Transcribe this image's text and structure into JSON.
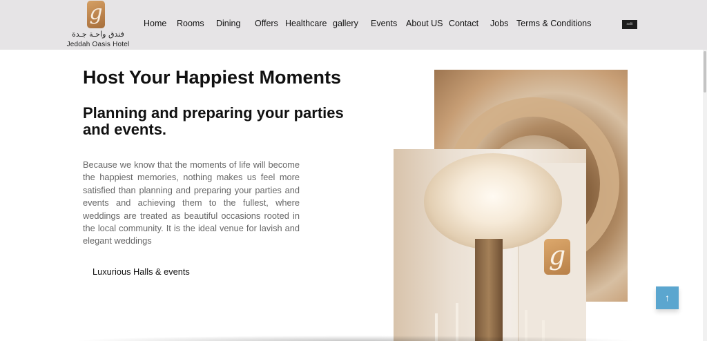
{
  "header": {
    "logo": {
      "glyph": "g",
      "arabic_name": "فندق واحـة جـدة",
      "english_name": "Jeddah Oasis Hotel"
    },
    "nav": [
      {
        "label": "Home"
      },
      {
        "label": "Rooms"
      },
      {
        "label": "Dining"
      },
      {
        "label": "Offers"
      },
      {
        "label": "Healthcare"
      },
      {
        "label": "gallery"
      },
      {
        "label": "Events"
      },
      {
        "label": "About US"
      },
      {
        "label": "Contact"
      },
      {
        "label": "Jobs"
      },
      {
        "label": "Terms & Conditions"
      }
    ],
    "language_badge": "salit"
  },
  "main": {
    "title": "Host Your Happiest Moments",
    "subtitle": "Planning and preparing your parties and events.",
    "body": "Because we know that the moments of life will become the happiest memories, nothing makes us feel more satisfied than planning and preparing your parties and events and achieving them to the fullest, where weddings are treated as beautiful occasions rooted in the local community. It is the ideal venue for lavish and elegant weddings",
    "link_label": "Luxurious Halls & events"
  },
  "back_to_top": {
    "icon": "arrow-up-icon",
    "glyph": "↑"
  },
  "colors": {
    "header_bg": "#e6e4e6",
    "brand_gold": "#c08a52",
    "back_to_top_bg": "#5ba6cf",
    "body_text": "#666666"
  }
}
